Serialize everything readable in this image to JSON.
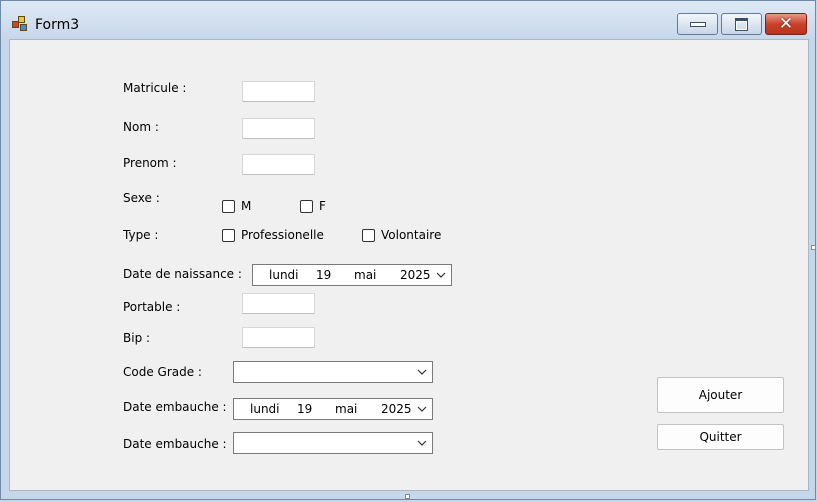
{
  "window": {
    "title": "Form3"
  },
  "form": {
    "matricule_label": "Matricule :",
    "nom_label": "Nom :",
    "prenom_label": "Prenom :",
    "sexe_label": "Sexe :",
    "sexe_m": "M",
    "sexe_f": "F",
    "type_label": "Type :",
    "type_pro": "Professionelle",
    "type_vol": "Volontaire",
    "date_naissance_label": "Date de naissance :",
    "date_naissance": {
      "day_name": "lundi",
      "day": "19",
      "month": "mai",
      "year": "2025"
    },
    "portable_label": "Portable :",
    "bip_label": "Bip :",
    "code_grade_label": "Code Grade :",
    "date_embauche_label": "Date embauche :",
    "date_embauche": {
      "day_name": "lundi",
      "day": "19",
      "month": "mai",
      "year": "2025"
    },
    "date_embauche2_label": "Date embauche :"
  },
  "buttons": {
    "ajouter": "Ajouter",
    "quitter": "Quitter"
  },
  "icons": {
    "app": "form-app-icon",
    "minimize": "minimize-icon",
    "maximize": "maximize-icon",
    "close": "close-icon",
    "dropdown": "chevron-down-icon"
  }
}
